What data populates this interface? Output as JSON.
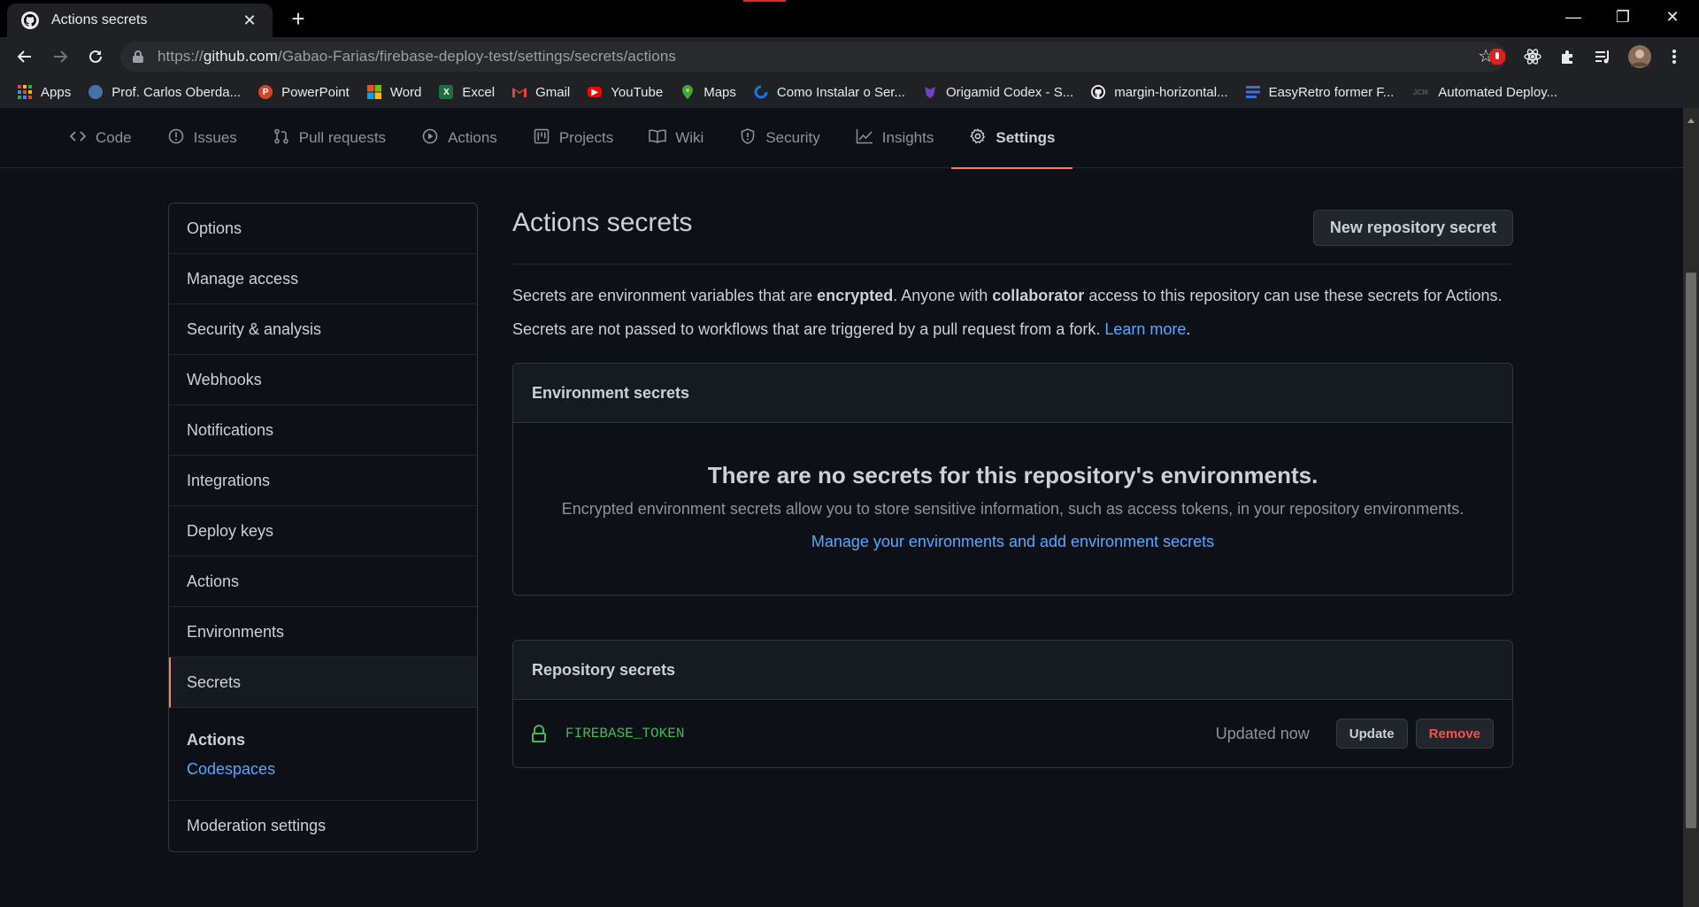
{
  "browser": {
    "tab_title": "Actions secrets",
    "new_tab_symbol": "+",
    "url_prefix": "https://",
    "url_host": "github.com",
    "url_path": "/Gabao-Farias/firebase-deploy-test/settings/secrets/actions",
    "window_controls": {
      "minimize": "—",
      "restore": "❐",
      "close": "✕"
    },
    "extensions": [
      "adblock-icon",
      "react-devtools-icon",
      "puzzle-icon",
      "playlist-icon",
      "profile-avatar",
      "kebab-menu-icon"
    ]
  },
  "bookmarks": [
    {
      "label": "Apps",
      "icon": "apps-grid-icon",
      "color": "#ea4335"
    },
    {
      "label": "Prof. Carlos Oberda...",
      "icon": "profile-icon",
      "color": "#4a6fa5"
    },
    {
      "label": "PowerPoint",
      "icon": "powerpoint-icon",
      "color": "#d24726"
    },
    {
      "label": "Word",
      "icon": "microsoft-icon",
      "color": "#2b7cd3"
    },
    {
      "label": "Excel",
      "icon": "excel-icon",
      "color": "#1d6f42"
    },
    {
      "label": "Gmail",
      "icon": "gmail-icon",
      "color": "#ea4335"
    },
    {
      "label": "YouTube",
      "icon": "youtube-icon",
      "color": "#ff0000"
    },
    {
      "label": "Maps",
      "icon": "maps-icon",
      "color": "#34a853"
    },
    {
      "label": "Como Instalar o Ser...",
      "icon": "loading-icon",
      "color": "#1a73e8"
    },
    {
      "label": "Origamid Codex - S...",
      "icon": "origamid-icon",
      "color": "#6e40c9"
    },
    {
      "label": "margin-horizontal...",
      "icon": "github-icon",
      "color": "#e8eaed"
    },
    {
      "label": "EasyRetro former F...",
      "icon": "easyretro-icon",
      "color": "#3b6fd8"
    },
    {
      "label": "Automated Deploy...",
      "icon": "jcm-icon",
      "color": "#202124"
    }
  ],
  "repo_nav": [
    {
      "label": "Code",
      "icon": "<>",
      "active": false
    },
    {
      "label": "Issues",
      "icon": "ⓘ",
      "active": false
    },
    {
      "label": "Pull requests",
      "icon": "⇅",
      "active": false
    },
    {
      "label": "Actions",
      "icon": "▷",
      "active": false
    },
    {
      "label": "Projects",
      "icon": "▥",
      "active": false
    },
    {
      "label": "Wiki",
      "icon": "🕮",
      "active": false
    },
    {
      "label": "Security",
      "icon": "⛉",
      "active": false
    },
    {
      "label": "Insights",
      "icon": "📈",
      "active": false
    },
    {
      "label": "Settings",
      "icon": "⚙",
      "active": true
    }
  ],
  "settings_menu": {
    "items": [
      "Options",
      "Manage access",
      "Security & analysis",
      "Webhooks",
      "Notifications",
      "Integrations",
      "Deploy keys",
      "Actions",
      "Environments",
      "Secrets"
    ],
    "selected": "Secrets",
    "group": {
      "title": "Actions",
      "link": "Codespaces"
    },
    "last_item": "Moderation settings"
  },
  "main": {
    "title": "Actions secrets",
    "new_button": "New repository secret",
    "desc_line1": {
      "part1": "Secrets are environment variables that are ",
      "bold1": "encrypted",
      "part2": ". Anyone with ",
      "bold2": "collaborator",
      "part3": " access to this repository can use these secrets for Actions."
    },
    "desc_line2": {
      "text": "Secrets are not passed to workflows that are triggered by a pull request from a fork. ",
      "link": "Learn more",
      "end": "."
    },
    "env_box": {
      "header": "Environment secrets",
      "blank_title": "There are no secrets for this repository's environments.",
      "blank_desc": "Encrypted environment secrets allow you to store sensitive information, such as access tokens, in your repository environments.",
      "blank_link": "Manage your environments and add environment secrets"
    },
    "repo_box": {
      "header": "Repository secrets",
      "secrets": [
        {
          "name": "FIREBASE_TOKEN",
          "updated": "Updated now",
          "update_label": "Update",
          "remove_label": "Remove"
        }
      ]
    }
  }
}
